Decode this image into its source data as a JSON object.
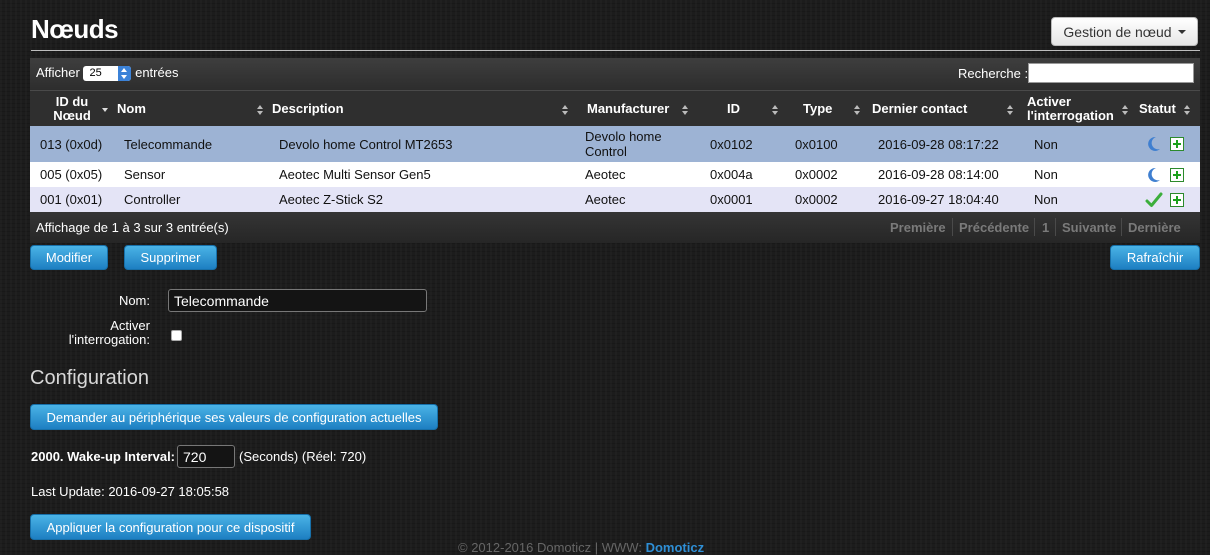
{
  "header": {
    "title": "Nœuds",
    "dropdown_label": "Gestion de nœud"
  },
  "table_controls": {
    "show_label": "Afficher",
    "page_length": "25",
    "entries_label": "entrées",
    "search_label": "Recherche :",
    "search_value": ""
  },
  "columns": [
    "ID du Nœud",
    "Nom",
    "Description",
    "Manufacturer",
    "ID",
    "Type",
    "Dernier contact",
    "Activer l'interrogation",
    "Statut"
  ],
  "rows": [
    {
      "node_id": "013 (0x0d)",
      "name": "Telecommande",
      "description": "Devolo home Control MT2653",
      "manufacturer": "Devolo home Control",
      "id": "0x0102",
      "type": "0x0100",
      "last_contact": "2016-09-28 08:17:22",
      "polling": "Non",
      "status_icon": "moon-icon",
      "selected": true
    },
    {
      "node_id": "005 (0x05)",
      "name": "Sensor",
      "description": "Aeotec Multi Sensor Gen5",
      "manufacturer": "Aeotec",
      "id": "0x004a",
      "type": "0x0002",
      "last_contact": "2016-09-28 08:14:00",
      "polling": "Non",
      "status_icon": "moon-icon",
      "selected": false
    },
    {
      "node_id": "001 (0x01)",
      "name": "Controller",
      "description": "Aeotec Z-Stick S2",
      "manufacturer": "Aeotec",
      "id": "0x0001",
      "type": "0x0002",
      "last_contact": "2016-09-27 18:04:40",
      "polling": "Non",
      "status_icon": "checkmark-icon",
      "selected": false
    }
  ],
  "table_footer": {
    "info": "Affichage de 1 à 3 sur 3 entrée(s)",
    "first": "Première",
    "previous": "Précédente",
    "page": "1",
    "next": "Suivante",
    "last": "Dernière"
  },
  "actions": {
    "modify": "Modifier",
    "delete": "Supprimer",
    "refresh": "Rafraîchir"
  },
  "form": {
    "name_label": "Nom:",
    "name_value": "Telecommande",
    "polling_label": "Activer l'interrogation:",
    "polling_checked": false
  },
  "configuration": {
    "title": "Configuration",
    "request_button": "Demander au périphérique ses valeurs de configuration actuelles",
    "param_label": "2000. Wake-up Interval:",
    "param_value": "720",
    "param_suffix": "(Seconds) (Réel: 720)",
    "last_update": "Last Update: 2016-09-27 18:05:58",
    "apply_button": "Appliquer la configuration pour ce dispositif"
  },
  "footer": {
    "text": "© 2012-2016 Domoticz | WWW: ",
    "link": "Domoticz"
  },
  "colors": {
    "selected_row": "#9db3d4",
    "alt_row": "#e4e4f6",
    "button_blue": "#2b95d6"
  }
}
